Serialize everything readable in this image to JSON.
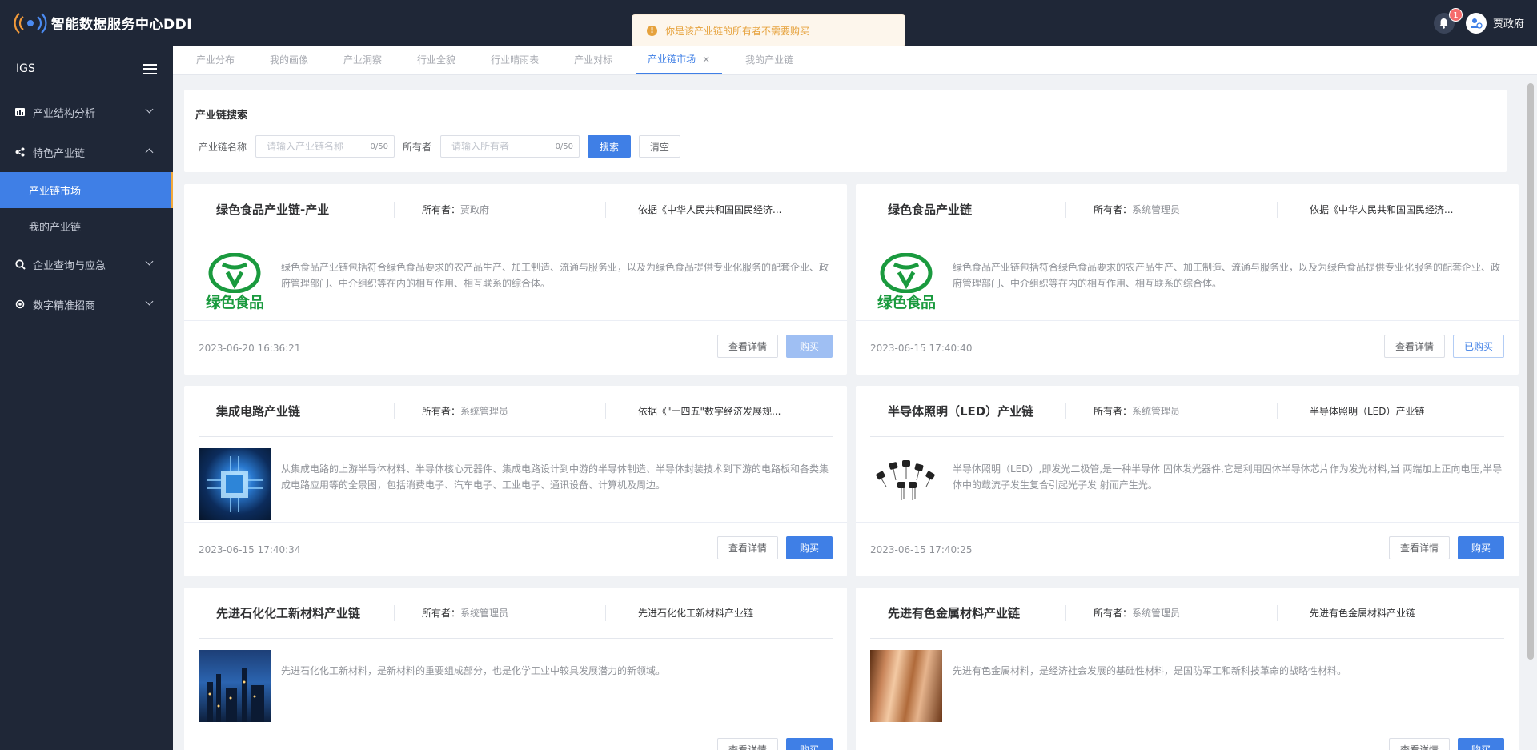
{
  "app": {
    "title": "智能数据服务中心DDI",
    "notifications": "1",
    "username": "贾政府"
  },
  "toast": {
    "message": "你是该产业链的所有者不需要购买",
    "icon": "warning-icon",
    "color": "#e6a23c"
  },
  "sidebar": {
    "header": "IGS",
    "items": [
      {
        "label": "产业结构分析",
        "icon": "bar-chart-icon",
        "expanded": false
      },
      {
        "label": "特色产业链",
        "icon": "share-icon",
        "expanded": true
      },
      {
        "label": "企业查询与应急",
        "icon": "search-icon",
        "expanded": false
      },
      {
        "label": "数字精准招商",
        "icon": "target-icon",
        "expanded": false
      }
    ],
    "subitems": [
      {
        "label": "产业链市场",
        "active": true
      },
      {
        "label": "我的产业链",
        "active": false
      }
    ]
  },
  "tabs": [
    {
      "label": "产业分布"
    },
    {
      "label": "我的画像"
    },
    {
      "label": "产业洞察"
    },
    {
      "label": "行业全貌"
    },
    {
      "label": "行业晴雨表"
    },
    {
      "label": "产业对标"
    },
    {
      "label": "产业链市场",
      "active": true
    },
    {
      "label": "我的产业链"
    }
  ],
  "search": {
    "title": "产业链搜索",
    "name_label": "产业链名称",
    "name_placeholder": "请输入产业链名称",
    "name_count": "0/50",
    "owner_label": "所有者",
    "owner_placeholder": "请输入所有者",
    "owner_count": "0/50",
    "search_button": "搜索",
    "clear_button": "清空"
  },
  "labels": {
    "owner_key": "所有者：",
    "detail_button": "查看详情",
    "buy_button": "购买",
    "bought_button": "已购买"
  },
  "cards": [
    {
      "title": "绿色食品产业链-产业",
      "owner": "贾政府",
      "basis": "依据《中华人民共和国国民经济...",
      "image": "green-food-logo",
      "logo_text": "绿色食品",
      "description": "绿色食品产业链包括符合绿色食品要求的农产品生产、加工制造、流通与服务业，以及为绿色食品提供专业化服务的配套企业、政府管理部门、中介组织等在内的相互作用、相互联系的综合体。",
      "time": "2023-06-20 16:36:21",
      "status": "buy-disabled"
    },
    {
      "title": "绿色食品产业链",
      "owner": "系统管理员",
      "basis": "依据《中华人民共和国国民经济...",
      "image": "green-food-logo",
      "logo_text": "绿色食品",
      "description": "绿色食品产业链包括符合绿色食品要求的农产品生产、加工制造、流通与服务业，以及为绿色食品提供专业化服务的配套企业、政府管理部门、中介组织等在内的相互作用、相互联系的综合体。",
      "time": "2023-06-15 17:40:40",
      "status": "bought"
    },
    {
      "title": "集成电路产业链",
      "owner": "系统管理员",
      "basis": "依据《\"十四五\"数字经济发展规...",
      "image": "chip-image",
      "description": "从集成电路的上游半导体材料、半导体核心元器件、集成电路设计到中游的半导体制造、半导体封装技术到下游的电路板和各类集成电路应用等的全景图，包括消费电子、汽车电子、工业电子、通讯设备、计算机及周边。",
      "time": "2023-06-15 17:40:34",
      "status": "buy"
    },
    {
      "title": "半导体照明（LED）产业链",
      "owner": "系统管理员",
      "basis": "半导体照明（LED）产业链",
      "image": "led-image",
      "description": "半导体照明（LED）,即发光二极管,是一种半导体 固体发光器件,它是利用固体半导体芯片作为发光材料,当 两端加上正向电压,半导体中的载流子发生复合引起光子发 射而产生光。",
      "time": "2023-06-15 17:40:25",
      "status": "buy"
    },
    {
      "title": "先进石化化工新材料产业链",
      "owner": "系统管理员",
      "basis": "先进石化化工新材料产业链",
      "image": "petrochemical-image",
      "description": "先进石化化工新材料，是新材料的重要组成部分，也是化学工业中较具发展潜力的新领域。",
      "time": "",
      "status": "buy"
    },
    {
      "title": "先进有色金属材料产业链",
      "owner": "系统管理员",
      "basis": "先进有色金属材料产业链",
      "image": "metal-image",
      "description": "先进有色金属材料，是经济社会发展的基础性材料，是国防军工和新科技革命的战略性材料。",
      "time": "",
      "status": "buy"
    }
  ]
}
